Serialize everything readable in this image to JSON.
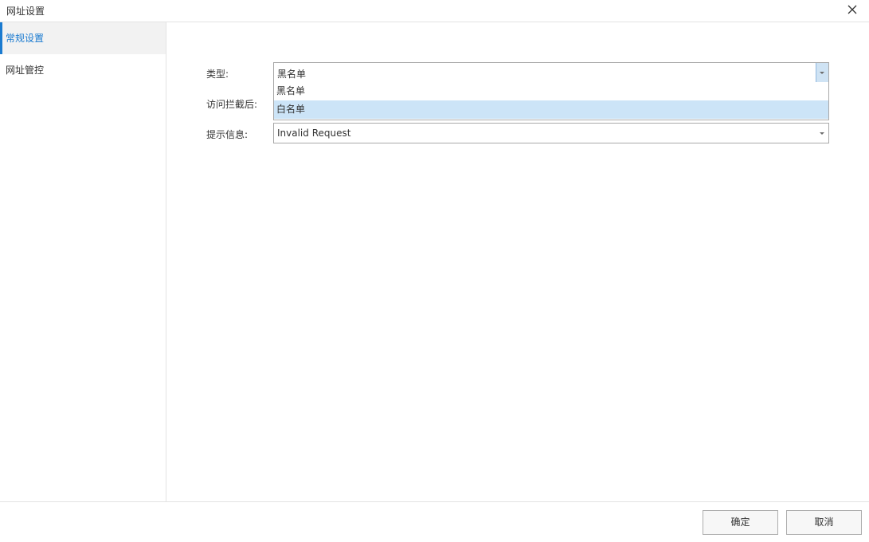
{
  "window": {
    "title": "网址设置"
  },
  "sidebar": {
    "items": [
      {
        "label": "常规设置",
        "active": true
      },
      {
        "label": "网址管控",
        "active": false
      }
    ]
  },
  "form": {
    "type": {
      "label": "类型:",
      "value": "黑名单",
      "options": [
        "黑名单",
        "白名单"
      ],
      "highlighted_option": "白名单"
    },
    "after_block": {
      "label": "访问拦截后:"
    },
    "message": {
      "label": "提示信息:",
      "value": "Invalid Request"
    }
  },
  "footer": {
    "ok_label": "确定",
    "cancel_label": "取消"
  },
  "colors": {
    "accent": "#1b7bd0",
    "highlight": "#cce4f7"
  }
}
